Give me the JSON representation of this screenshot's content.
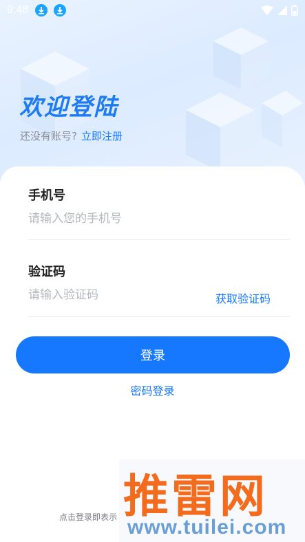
{
  "status_bar": {
    "time": "9:48",
    "icons": [
      "download-icon",
      "download-icon",
      "wifi-icon",
      "signal-icon",
      "battery-icon"
    ]
  },
  "header": {
    "welcome_title": "欢迎登陆",
    "no_account_text": "还没有账号?",
    "register_link": "立即注册"
  },
  "form": {
    "phone_label": "手机号",
    "phone_placeholder": "请输入您的手机号",
    "phone_value": "",
    "code_label": "验证码",
    "code_placeholder": "请输入验证码",
    "code_value": "",
    "get_code_label": "获取验证码"
  },
  "actions": {
    "login_label": "登录",
    "password_login_label": "密码登录"
  },
  "footer": {
    "agreement_text": "点击登录即表示"
  },
  "watermark": {
    "title": "推雷网",
    "url": "www.tuilei.com"
  },
  "colors": {
    "accent": "#1677ff",
    "title": "#1f7bf0",
    "watermark_orange": "#f36b1c",
    "watermark_blue": "#6a9fd6"
  }
}
